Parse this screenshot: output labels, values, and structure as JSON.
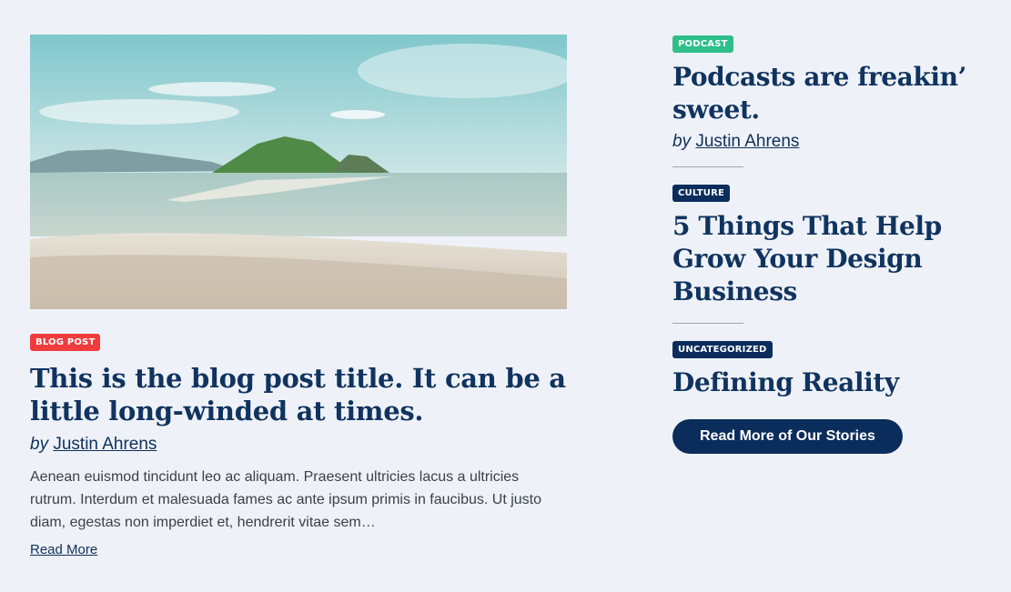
{
  "featured": {
    "image_alt": "Beach with small green island",
    "category": "BLOG POST",
    "title": "This is the blog post title. It can be a little long-winded at times.",
    "by": "by",
    "author": "Justin Ahrens",
    "excerpt": "Aenean euismod tincidunt leo ac aliquam. Praesent ultricies lacus a ultricies rutrum. Interdum et malesuada fames ac ante ipsum primis in faucibus. Ut justo diam, egestas non imperdiet et, hendrerit vitae sem…",
    "read_more": "Read More"
  },
  "sidebar": {
    "posts": [
      {
        "category": "PODCAST",
        "title": "Podcasts are freakin’ sweet.",
        "by": "by",
        "author": "Justin Ahrens"
      },
      {
        "category": "CULTURE",
        "title": "5 Things That Help Grow Your Design Business"
      },
      {
        "category": "UNCATEGORIZED",
        "title": "Defining Reality"
      }
    ],
    "cta": "Read More of Our Stories"
  },
  "colors": {
    "background": "#eef2f8",
    "navy": "#0b2d5c",
    "badge_red": "#ef3c3c",
    "badge_green": "#2fbf8a"
  }
}
